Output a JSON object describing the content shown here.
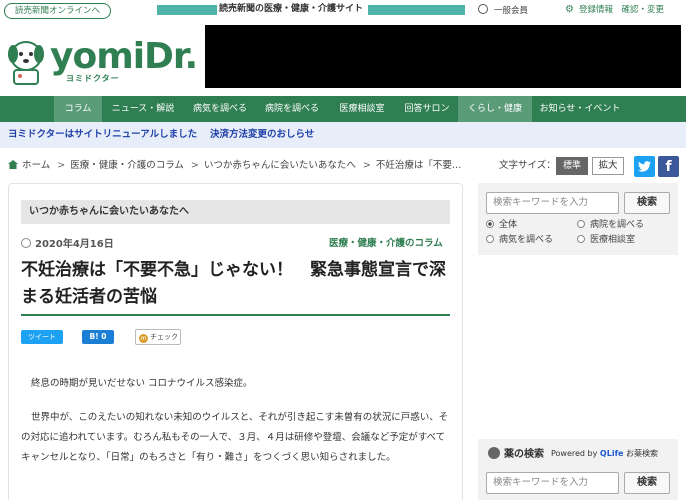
{
  "topbar": {
    "online_link": "読売新聞オンラインへ",
    "site_name": "読売新聞の医療・健康・介護サイト",
    "member_label": "一般会員",
    "settings_label": "登録情報　確認・変更"
  },
  "logo": {
    "word": "yomiDr.",
    "sub": "ヨミドクター"
  },
  "nav": {
    "items": [
      "コラム",
      "ニュース・解説",
      "病気を調べる",
      "病院を調べる",
      "医療相談室",
      "回答サロン",
      "くらし・健康",
      "お知らせ・イベント"
    ]
  },
  "notice": {
    "renewal": "ヨミドクターはサイトリニューアルしました",
    "payment": "決済方法変更のおしらせ"
  },
  "breadcrumb": {
    "home": "ホーム",
    "items": [
      "医療・健康・介護のコラム",
      "いつか赤ちゃんに会いたいあなたへ",
      "不妊治療は「不要…"
    ]
  },
  "font_size": {
    "label": "文字サイズ：",
    "standard": "標準",
    "large": "拡大"
  },
  "social": {
    "twitter_glyph": "🐦",
    "facebook_glyph": "f"
  },
  "article": {
    "series": "いつか赤ちゃんに会いたいあなたへ",
    "date": "2020年4月16日",
    "category": "医療・健康・介護のコラム",
    "title": "不妊治療は「不要不急」じゃない！　緊急事態宣言で深まる妊活者の苦悩",
    "share": {
      "tweet": "ツイート",
      "hatena": "B! 0",
      "mixi": "チェック"
    },
    "paragraphs": [
      "終息の時期が見いだせない コロナウイルス感染症。",
      "世界中が、このえたいの知れない未知のウイルスと、それが引き起こす未曽有の状況に戸惑い、その対応に追われています。むろん私もその一人で、３月、４月は研修や登壇、会議など予定がすべてキャンセルとなり、「日常」のもろさと「有り・難さ」をつくづく思い知らされました。"
    ]
  },
  "sidebar": {
    "search": {
      "placeholder": "検索キーワードを入力",
      "button": "検索",
      "options": [
        "全体",
        "病院を調べる",
        "病気を調べる",
        "医療相談室"
      ],
      "selected": "全体"
    },
    "drug_search": {
      "title": "薬の検索",
      "powered_prefix": "Powered by ",
      "powered_brand": "QLife",
      "powered_suffix": " お薬検索",
      "placeholder": "検索キーワードを入力",
      "button": "検索"
    }
  },
  "colors": {
    "brand_green": "#2f7f52",
    "nav_active": "#5a9b78",
    "notice_bg": "#e8eef9",
    "notice_text": "#1e3fa8",
    "placeholder_teal": "#4fb3a8",
    "twitter": "#1da1f2",
    "facebook": "#3b5998"
  }
}
